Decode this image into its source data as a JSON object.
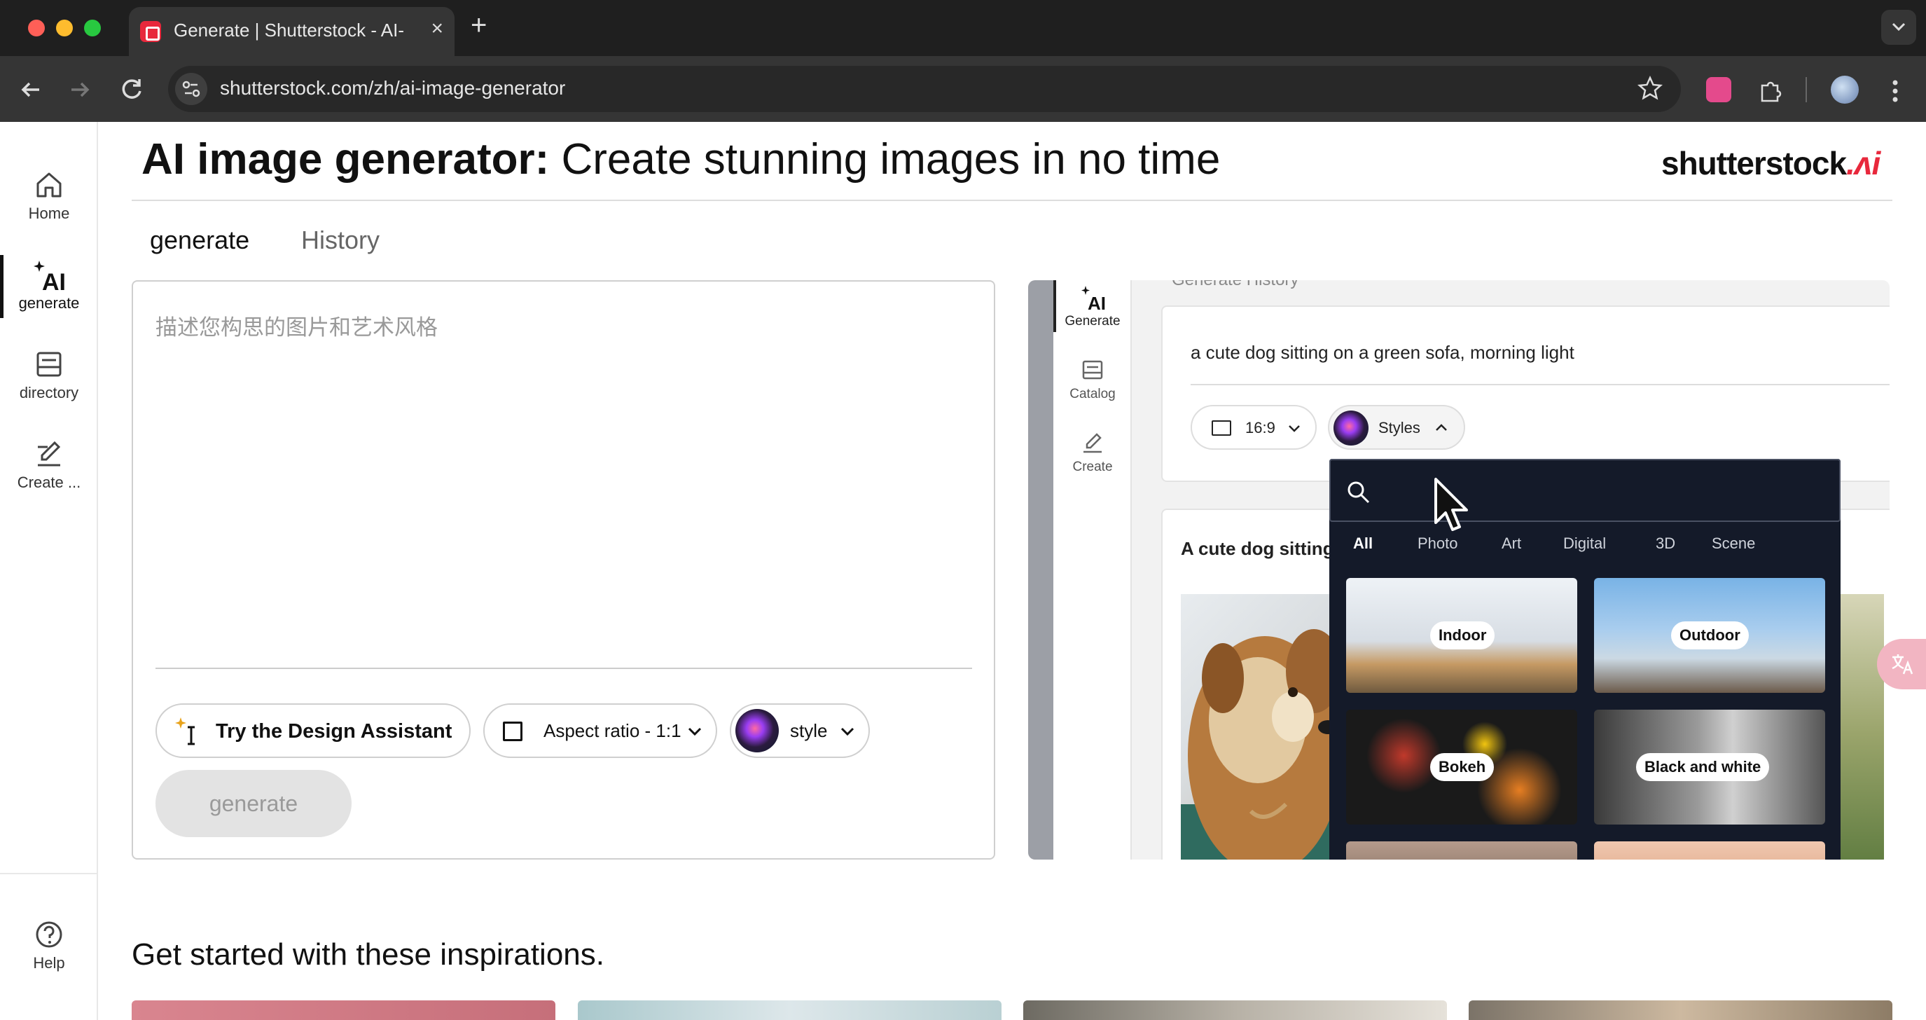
{
  "browser": {
    "tab_title": "Generate | Shutterstock - AI-",
    "url": "shutterstock.com/zh/ai-image-generator"
  },
  "rail": {
    "items": [
      {
        "label": "Home",
        "icon": "home-icon"
      },
      {
        "label": "generate",
        "icon": "ai-sparkle-icon"
      },
      {
        "label": "directory",
        "icon": "tray-icon"
      },
      {
        "label": "Create ...",
        "icon": "edit-icon"
      }
    ],
    "help_label": "Help"
  },
  "header": {
    "title_bold": "AI image generator:",
    "title_rest": " Create stunning images in no time",
    "logo_text": "shutterstock",
    "logo_ai": ".ᴧi"
  },
  "tabs": {
    "generate": "generate",
    "history": "History"
  },
  "prompt": {
    "placeholder": "描述您构思的图片和艺术风格",
    "value": ""
  },
  "controls": {
    "design_assistant": "Try the Design Assistant",
    "aspect_ratio": "Aspect ratio - 1:1",
    "style": "style",
    "generate": "generate"
  },
  "preview": {
    "rail": [
      {
        "label": "Generate",
        "icon": "ai-sparkle-icon"
      },
      {
        "label": "Catalog",
        "icon": "tray-icon"
      },
      {
        "label": "Create",
        "icon": "edit-icon"
      }
    ],
    "top_text": "Generate     History",
    "prompt": "a cute dog sitting on a green sofa, morning light",
    "ratio": "16:9",
    "styles_label": "Styles",
    "result_title": "A cute dog sitting",
    "categories": [
      "All",
      "Photo",
      "Art",
      "Digital",
      "3D",
      "Scene"
    ],
    "tiles": [
      "Indoor",
      "Outdoor",
      "Bokeh",
      "Black and white"
    ]
  },
  "inspirations": {
    "title": "Get started with these inspirations."
  },
  "colors": {
    "brand_red": "#e8283c",
    "popup_bg": "#141a29"
  }
}
